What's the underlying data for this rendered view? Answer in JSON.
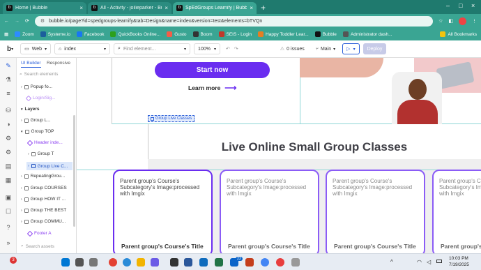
{
  "browser": {
    "tabs": [
      {
        "label": "Home | Bubble",
        "active": false
      },
      {
        "label": "All - Activity - joilieparker - Bubb",
        "active": false
      },
      {
        "label": "SpEdGroups Learnify | Bubble E",
        "active": true
      }
    ],
    "new_tab": "+",
    "url": "bubble.io/page?id=spedgroups-learnify&tab=Design&name=index&version=test&elements=bTVQn",
    "bookmarks": [
      {
        "label": "Zoom",
        "color": "#2d8cff"
      },
      {
        "label": "Systeme.io",
        "color": "#1b5e9c"
      },
      {
        "label": "Facebook",
        "color": "#1877f2"
      },
      {
        "label": "QuickBooks Online...",
        "color": "#2ca01c"
      },
      {
        "label": "Gusto",
        "color": "#f45d48"
      },
      {
        "label": "Boom",
        "color": "#333333"
      },
      {
        "label": "SEIS - Login",
        "color": "#c0392b"
      },
      {
        "label": "Happy Toddler Lear...",
        "color": "#e67e22"
      },
      {
        "label": "Bubble",
        "color": "#111111"
      },
      {
        "label": "Administrator dash...",
        "color": "#555555"
      }
    ],
    "all_bookmarks": "All Bookmarks"
  },
  "editor": {
    "device": "Web",
    "page": "index",
    "find_placeholder": "Find element...",
    "zoom": "100%",
    "issues": "0 issues",
    "branch": "Main",
    "deploy": "Deploy"
  },
  "left_panel": {
    "tabs": [
      "UI Builder",
      "Responsive"
    ],
    "search_placeholder": "Search elements",
    "items_top": [
      "Popup fo...",
      "Login/Sig..."
    ],
    "layers_label": "Layers",
    "layers": [
      {
        "label": "Group L...",
        "selected": false,
        "purple": false,
        "indent": 0
      },
      {
        "label": "Group TOP",
        "selected": false,
        "purple": false,
        "indent": 0
      },
      {
        "label": "Header inde...",
        "selected": false,
        "purple": true,
        "indent": 1
      },
      {
        "label": "Group T",
        "selected": false,
        "purple": false,
        "indent": 1
      },
      {
        "label": "Group Live C...",
        "selected": true,
        "purple": false,
        "indent": 1
      },
      {
        "label": "RepeatingGrou...",
        "selected": false,
        "purple": false,
        "indent": 0
      },
      {
        "label": "Group COURSES",
        "selected": false,
        "purple": false,
        "indent": 0
      },
      {
        "label": "Group HOW IT ...",
        "selected": false,
        "purple": false,
        "indent": 0
      },
      {
        "label": "Group THE BEST",
        "selected": false,
        "purple": false,
        "indent": 0
      },
      {
        "label": "Group COMMU...",
        "selected": false,
        "purple": false,
        "indent": 0
      },
      {
        "label": "Footer A",
        "selected": false,
        "purple": true,
        "indent": 0
      }
    ],
    "search_assets": "Search assets"
  },
  "canvas": {
    "start_now": "Start now",
    "learn_more": "Learn more",
    "group_tag": "Group Live Classes",
    "section_title": "Live Online Small Group Classes",
    "card_image_text": "Parent group's Course's Subcategory's Image:processed with Imgix",
    "card_title": "Parent group's Course's Title",
    "accent": "#6a2df0"
  },
  "taskbar": {
    "time": "10:03 PM",
    "date": "7/19/2025",
    "badge": "3",
    "mail_badge": "22"
  }
}
